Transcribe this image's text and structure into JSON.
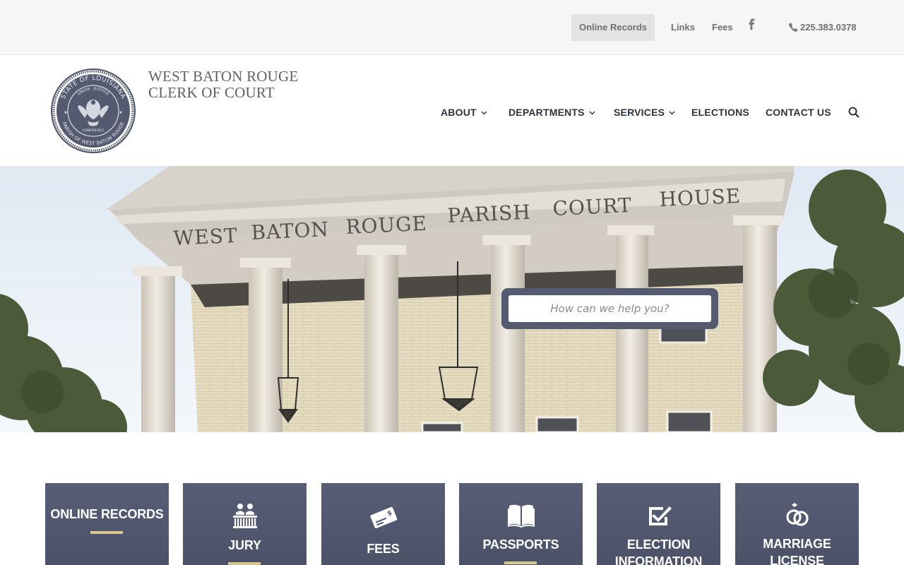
{
  "topbar": {
    "online_records": "Online Records",
    "links": "Links",
    "fees": "Fees",
    "facebook_icon": "facebook-icon",
    "phone": "225.383.0378"
  },
  "header": {
    "title_line1": "WEST BATON ROUGE",
    "title_line2": "CLERK OF COURT",
    "seal_text_top": "STATE OF LOUISIANA",
    "seal_text_bottom": "PARISH OF WEST BATON ROUGE",
    "seal_union": "UNION",
    "seal_justice": "JUSTICE",
    "seal_confidence": "CONFIDENCE"
  },
  "nav": {
    "items": [
      {
        "label": "ABOUT",
        "dropdown": true
      },
      {
        "label": "DEPARTMENTS",
        "dropdown": true
      },
      {
        "label": "SERVICES",
        "dropdown": true
      },
      {
        "label": "ELECTIONS",
        "dropdown": false
      },
      {
        "label": "CONTACT US",
        "dropdown": false
      }
    ],
    "search_icon": "search-icon"
  },
  "hero": {
    "inscription": [
      "WEST",
      "BATON",
      "ROUGE",
      "PARISH",
      "COURT",
      "HOUSE"
    ],
    "search_placeholder": "How can we help you?"
  },
  "tiles": [
    {
      "label": "ONLINE RECORDS",
      "icon": "none"
    },
    {
      "label": "JURY",
      "icon": "jury-box-icon"
    },
    {
      "label": "FEES",
      "icon": "check-payment-icon"
    },
    {
      "label": "PASSPORTS",
      "icon": "open-book-icon"
    },
    {
      "label": "ELECTION INFORMATION",
      "icon": "checkbox-icon"
    },
    {
      "label": "MARRIAGE LICENSE",
      "icon": "rings-icon"
    }
  ],
  "colors": {
    "tile_bg": "#50566d",
    "accent_bar": "#d7c98d",
    "nav_text": "#2e3340",
    "topbar_bg": "#f6f6f6"
  }
}
